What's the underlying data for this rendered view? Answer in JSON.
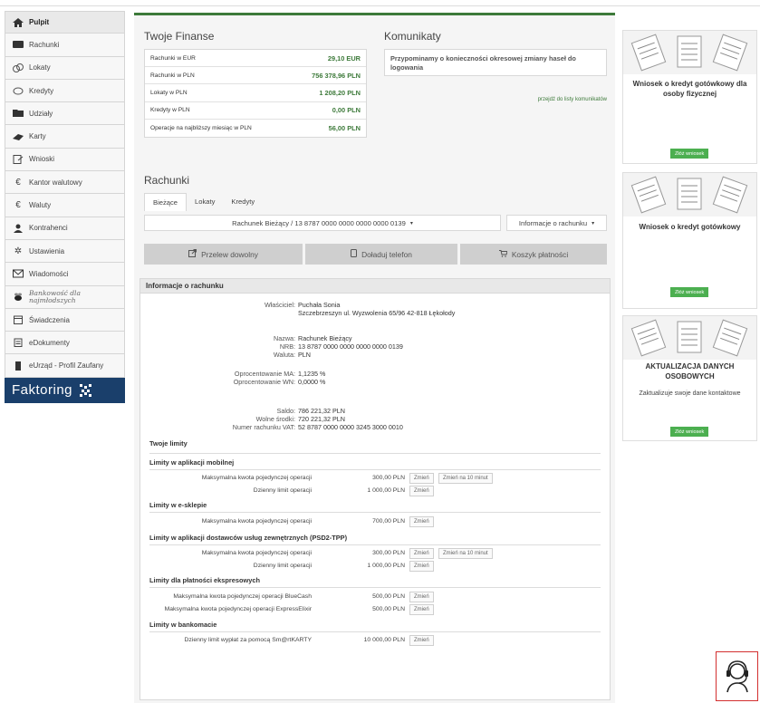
{
  "sidebar": {
    "items": [
      {
        "label": "Pulpit",
        "icon": "home-icon"
      },
      {
        "label": "Rachunki",
        "icon": "wallet-icon"
      },
      {
        "label": "Lokaty",
        "icon": "coins-icon"
      },
      {
        "label": "Kredyty",
        "icon": "piggy-bank-icon"
      },
      {
        "label": "Udziały",
        "icon": "folder-icon"
      },
      {
        "label": "Karty",
        "icon": "card-hand-icon"
      },
      {
        "label": "Wnioski",
        "icon": "form-icon"
      },
      {
        "label": "Kantor walutowy",
        "icon": "euro-icon"
      },
      {
        "label": "Waluty",
        "icon": "euro-icon"
      },
      {
        "label": "Kontrahenci",
        "icon": "contacts-icon"
      },
      {
        "label": "Ustawienia",
        "icon": "gear-icon"
      },
      {
        "label": "Wiadomości",
        "icon": "mail-icon"
      },
      {
        "label": "Bankowość dla najmłodszych",
        "icon": "bee-icon"
      },
      {
        "label": "Świadczenia",
        "icon": "calendar-icon"
      },
      {
        "label": "eDokumenty",
        "icon": "documents-icon"
      },
      {
        "label": "eUrząd - Profil Zaufany",
        "icon": "id-card-icon"
      }
    ],
    "faktoring": "Faktoring"
  },
  "finanse": {
    "title": "Twoje Finanse",
    "rows": [
      {
        "label": "Rachunki w EUR",
        "value": "29,10 EUR"
      },
      {
        "label": "Rachunki w PLN",
        "value": "756 378,96 PLN"
      },
      {
        "label": "Lokaty w PLN",
        "value": "1 208,20 PLN"
      },
      {
        "label": "Kredyty w PLN",
        "value": "0,00 PLN"
      },
      {
        "label": "Operacje na najbliższy miesiąc w PLN",
        "value": "56,00 PLN"
      }
    ]
  },
  "komunikaty": {
    "title": "Komunikaty",
    "message": "Przypominamy o konieczności okresowej zmiany haseł do logowania",
    "link": "przejdź do listy komunikatów"
  },
  "rachunki": {
    "title": "Rachunki",
    "tabs": [
      "Bieżące",
      "Lokaty",
      "Kredyty"
    ],
    "account_select": "Rachunek Bieżący / 13 8787 0000 0000 0000 0000 0139",
    "info_select": "Informacje o rachunku",
    "actions": [
      {
        "label": "Przelew dowolny",
        "icon": "transfer-icon"
      },
      {
        "label": "Doładuj telefon",
        "icon": "phone-icon"
      },
      {
        "label": "Koszyk płatności",
        "icon": "cart-icon"
      }
    ]
  },
  "info": {
    "title": "Informacje o rachunku",
    "wlasciciel_label": "Właściciel:",
    "wlasciciel_name": "Puchała Sonia",
    "wlasciciel_addr": "Szczebrzeszyn ul. Wyzwolenia 65/96 42-818 Łękołody",
    "nazwa_label": "Nazwa:",
    "nazwa": "Rachunek Bieżący",
    "nrb_label": "NRB:",
    "nrb": "13 8787 0000 0000 0000 0000 0139",
    "waluta_label": "Waluta:",
    "waluta": "PLN",
    "ma_label": "Oprocentowanie MA:",
    "ma": "1,1235 %",
    "wn_label": "Oprocentowanie WN:",
    "wn": "0,0000 %",
    "saldo_label": "Saldo:",
    "saldo": "786 221,32 PLN",
    "wolne_label": "Wolne środki:",
    "wolne": "720 221,32 PLN",
    "vat_label": "Numer rachunku VAT:",
    "vat": "52 8787 0000 0000 3245 3000 0010"
  },
  "limity": {
    "title": "Twoje limity",
    "change": "Zmień",
    "change10": "Zmień na 10 minut",
    "groups": [
      {
        "title": "Limity w aplikacji mobilnej",
        "rows": [
          {
            "label": "Maksymalna kwota pojedynczej operacji",
            "amount": "300,00 PLN",
            "ten": true
          },
          {
            "label": "Dzienny limit operacji",
            "amount": "1 000,00 PLN",
            "ten": false
          }
        ]
      },
      {
        "title": "Limity w e-sklepie",
        "rows": [
          {
            "label": "Maksymalna kwota pojedynczej operacji",
            "amount": "700,00 PLN",
            "ten": false
          }
        ]
      },
      {
        "title": "Limity w aplikacji dostawców usług zewnętrznych (PSD2-TPP)",
        "rows": [
          {
            "label": "Maksymalna kwota pojedynczej operacji",
            "amount": "300,00 PLN",
            "ten": true
          },
          {
            "label": "Dzienny limit operacji",
            "amount": "1 000,00 PLN",
            "ten": false
          }
        ]
      },
      {
        "title": "Limity dla płatności ekspresowych",
        "rows": [
          {
            "label": "Maksymalna kwota pojedynczej operacji BlueCash",
            "amount": "500,00 PLN",
            "ten": false
          },
          {
            "label": "Maksymalna kwota pojedynczej operacji ExpressElixir",
            "amount": "500,00 PLN",
            "ten": false
          }
        ]
      },
      {
        "title": "Limity w bankomacie",
        "rows": [
          {
            "label": "Dzienny limit wypłat za pomocą Sm@rtKARTY",
            "amount": "10 000,00 PLN",
            "ten": false
          }
        ]
      }
    ]
  },
  "ads": [
    {
      "title": "Wniosek o kredyt gotówkowy dla osoby fizycznej",
      "button": "Złóż wniosek"
    },
    {
      "title": "Wniosek o kredyt gotówkowy",
      "button": "Złóż wniosek"
    },
    {
      "title": "AKTUALIZACJA DANYCH OSOBOWYCH",
      "desc": "Zaktualizuje swoje dane kontaktowe",
      "button": "Złóż wniosek"
    }
  ],
  "support_icon": "headset-icon"
}
